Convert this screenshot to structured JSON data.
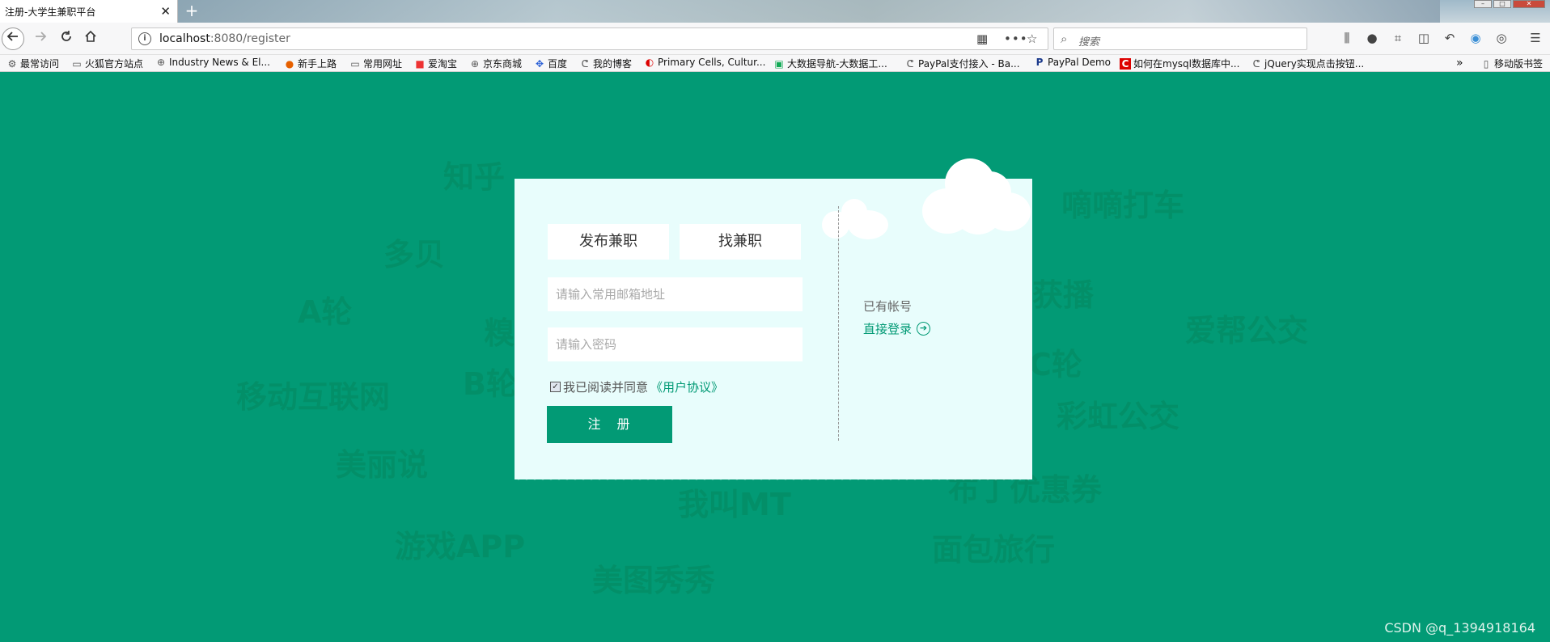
{
  "browser": {
    "tab_title": "注册-大学生兼职平台",
    "tab_close": "✕",
    "new_tab": "+",
    "url_host": "localhost",
    "url_rest": ":8080/register",
    "search_placeholder": "搜索"
  },
  "bookmarks": [
    {
      "label": "最常访问",
      "icon": "gear-icon"
    },
    {
      "label": "火狐官方站点",
      "icon": "folder-icon"
    },
    {
      "label": "Industry News & El...",
      "icon": "globe-icon"
    },
    {
      "label": "新手上路",
      "icon": "firefox-icon"
    },
    {
      "label": "常用网址",
      "icon": "folder-icon"
    },
    {
      "label": "爱淘宝",
      "icon": "taobao-icon"
    },
    {
      "label": "京东商城",
      "icon": "globe-icon"
    },
    {
      "label": "百度",
      "icon": "baidu-icon"
    },
    {
      "label": "我的博客",
      "icon": "blog-icon"
    },
    {
      "label": "Primary Cells, Cultur...",
      "icon": "site-icon"
    },
    {
      "label": "大数据导航-大数据工...",
      "icon": "site-icon"
    },
    {
      "label": "PayPal支付接入 - Ba...",
      "icon": "blog-icon"
    },
    {
      "label": "PayPal Demo",
      "icon": "paypal-icon"
    },
    {
      "label": "如何在mysql数据库中...",
      "icon": "csdn-icon"
    },
    {
      "label": "jQuery实现点击按钮...",
      "icon": "blog-icon"
    }
  ],
  "mobile_bookmarks": "移动版书签",
  "background_words": [
    "知乎",
    "嘀嘀打车",
    "多贝",
    "A轮",
    "爱帮公交",
    "移动互联网",
    "B轮",
    "C轮",
    "彩虹公交",
    "美丽说",
    "我叫MT",
    "布丁优惠券",
    "游戏APP",
    "面包旅行",
    "美图秀秀",
    "糗",
    "获播"
  ],
  "form": {
    "tab_post_job": "发布兼职",
    "tab_find_job": "找兼职",
    "email_placeholder": "请输入常用邮箱地址",
    "password_placeholder": "请输入密码",
    "agree_text": "我已阅读并同意",
    "agree_link": "《用户协议》",
    "register_button": "注　册"
  },
  "side": {
    "have_account": "已有帐号",
    "login_link": "直接登录"
  },
  "watermark": "CSDN @q_1394918164",
  "colors": {
    "brand": "#029a75",
    "card": "#e8fdfc"
  }
}
